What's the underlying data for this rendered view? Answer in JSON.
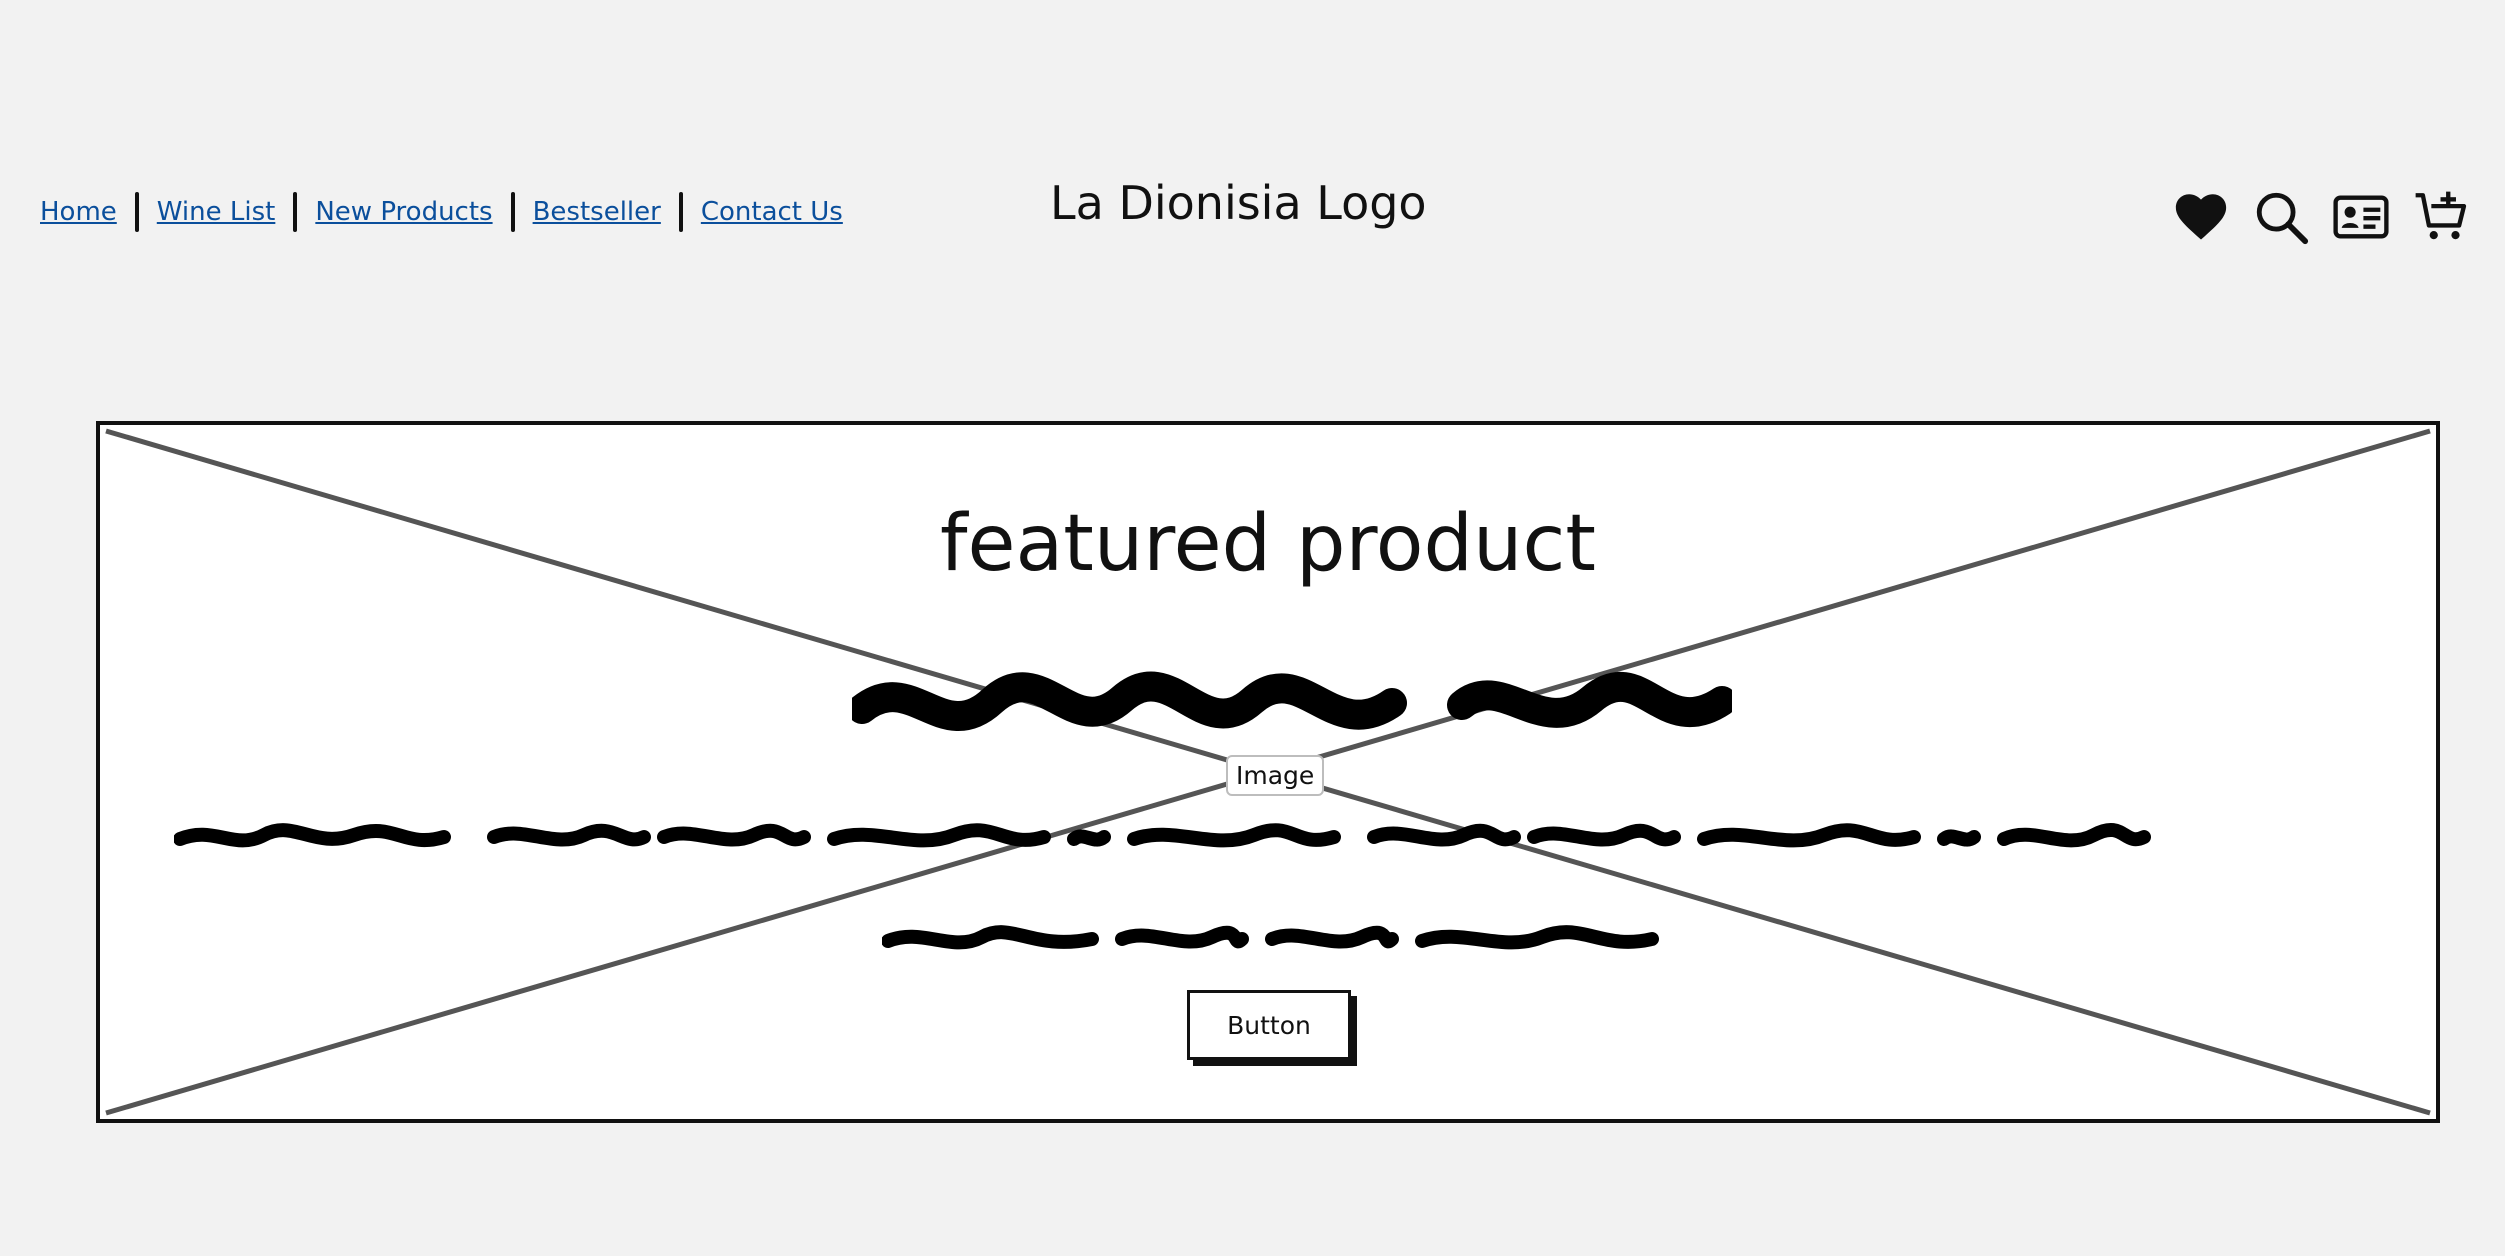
{
  "nav": {
    "items": [
      {
        "label": "Home"
      },
      {
        "label": "Wine List"
      },
      {
        "label": "New Products"
      },
      {
        "label": "Bestseller"
      },
      {
        "label": "Contact Us"
      }
    ]
  },
  "header": {
    "logo_text": "La Dionisia Logo",
    "icons": [
      "heart-icon",
      "search-icon",
      "account-card-icon",
      "add-to-cart-icon"
    ]
  },
  "featured": {
    "title": "featured product",
    "image_label": "Image",
    "button_label": "Button"
  },
  "colors": {
    "link": "#0b4f9c",
    "ink": "#111111",
    "placeholder_line": "#555555",
    "page_bg": "#f2f2f2"
  }
}
